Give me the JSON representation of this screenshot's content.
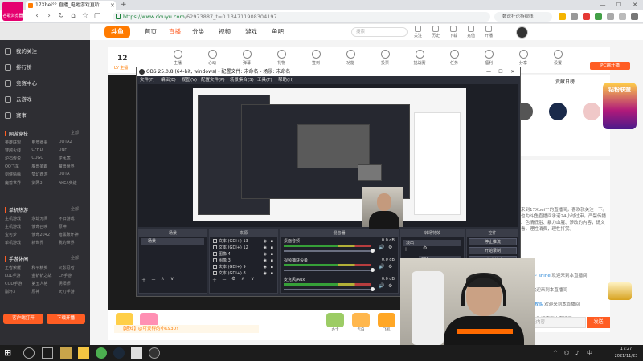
{
  "browser": {
    "tab_title": "17Xbei°° 直播_电地游戏直听",
    "tab_close": "✕",
    "tab_new": "+",
    "min": "—",
    "max": "☐",
    "close": "✕",
    "url_host": "https://www.douyu.com",
    "url_path": "/62973887_t=0.134711908304197",
    "search_placeholder": "数说社论持视线",
    "app_badge": "谷歌浏览器"
  },
  "site": {
    "logo": "斗鱼",
    "nav": [
      "首页",
      "直播",
      "分类",
      "视频",
      "游戏",
      "鱼吧"
    ],
    "search_placeholder": "搜索",
    "header_icons": [
      "关注",
      "历史",
      "下载",
      "充值",
      "开播"
    ]
  },
  "sidebar": {
    "top_items": [
      "我的关注",
      "排行榜",
      "竞赛中心",
      "云游戏"
    ],
    "esports_label": "赛事",
    "sections": [
      {
        "title": "网游竞技",
        "more": "全部",
        "games": [
          "英雄联盟",
          "电竞赛事",
          "DOTA2",
          "穿越火线",
          "CFHD",
          "DNF",
          "炉石传说",
          "CUGO",
          "逆水寒",
          "QQ飞车",
          "魔兽争霸",
          "魔兽世界",
          "剑侠情缘",
          "梦幻西游",
          "DOTA",
          "魔兽世界",
          "剑网3",
          "APEX英雄"
        ]
      },
      {
        "title": "单机热游",
        "more": "全部",
        "games": [
          "主机游戏",
          "永劫无间",
          "怀旧游戏",
          "主机游戏",
          "使命召唤",
          "原神",
          "宝可梦",
          "使命2042",
          "暗黑破坏神",
          "单机游戏",
          "新世界",
          "我的世界"
        ]
      },
      {
        "title": "手游休闲",
        "more": "全部",
        "games": [
          "王者荣耀",
          "和平精英",
          "火影忍者",
          "LOL手游",
          "金铲铲之战",
          "CF手游",
          "COD手游",
          "第五人格",
          "阴阳师",
          "崩坏3",
          "原神",
          "天刀手游"
        ]
      }
    ],
    "btn_open": "客户端打开",
    "btn_app": "下载开播"
  },
  "room": {
    "number": "12",
    "subtitle": "LV 主播",
    "icons": [
      "主播",
      "心动",
      "弹幕",
      "礼物",
      "签到",
      "功能",
      "投票",
      "挑战赛",
      "任务",
      "福利",
      "分享",
      "设置"
    ],
    "pc_badge": "PC端开播",
    "rank_title": "贡献日榜"
  },
  "obs": {
    "title": "OBS 25.0.8 (64-bit, windows) - 配置文件: 未命名 - 场景: 未命名",
    "menu": [
      "文件(F)",
      "编辑(E)",
      "视图(V)",
      "配置文件(P)",
      "场景集合(S)",
      "工具(T)",
      "帮助(H)"
    ],
    "docks": [
      "场景",
      "来源",
      "混音器",
      "转场特效",
      "控件"
    ],
    "scene_name": "场景",
    "sources": [
      "文本 (GDI+) 13",
      "文本 (GDI+) 12",
      "图像 4",
      "图像 3",
      "文本 (GDI+) 9",
      "文本 (GDI+) 8"
    ],
    "mixer": [
      {
        "name": "桌面音频",
        "value": "0.0 dB"
      },
      {
        "name": "视频捕获设备",
        "value": "0.0 dB"
      },
      {
        "name": "麦克风/Aux",
        "value": "0.0 dB"
      }
    ],
    "transition": "淡出",
    "duration_label": "时长",
    "duration_value": "300 ms",
    "controls": [
      "停止推流",
      "开始录制",
      "工作室模式",
      "设置",
      "退出"
    ],
    "status": "LIVE 00:00:00  REC 00:00:00  CPU: 8.9%, 60.00 fps"
  },
  "chat": {
    "lines": [
      {
        "user": "",
        "text": "欢迎来到17Xbei°°的直播间，喜欢就关注一下。斗鱼也为斗鱼直播间承诺24小时过审。严禁传播违规、色情低俗、暴力血腥、涉政的内容，请文明观看，理性消费，理性打赏。"
      },
      {
        "user": "Hypocrite~ shine",
        "text": "欢迎来到本直播间"
      },
      {
        "user": "APshou°",
        "text": "欢迎来到本直播间"
      },
      {
        "user": "金子是的我教练",
        "text": "欢迎来到本直播间"
      },
      {
        "user": "国风沙沙🎉",
        "text": "欢迎来到本直播间"
      }
    ],
    "input_placeholder": "这里输入聊天内容",
    "send": "发送"
  },
  "player": {
    "notice": "【通知】@可爱得的小K930!",
    "gifts": [
      "鱼丸",
      "荧光棒",
      "办卡",
      "告白",
      "飞机",
      "火箭"
    ]
  },
  "event_banner": "钻粉联盟",
  "taskbar": {
    "time": "17:27",
    "date": "2021/11/23"
  }
}
